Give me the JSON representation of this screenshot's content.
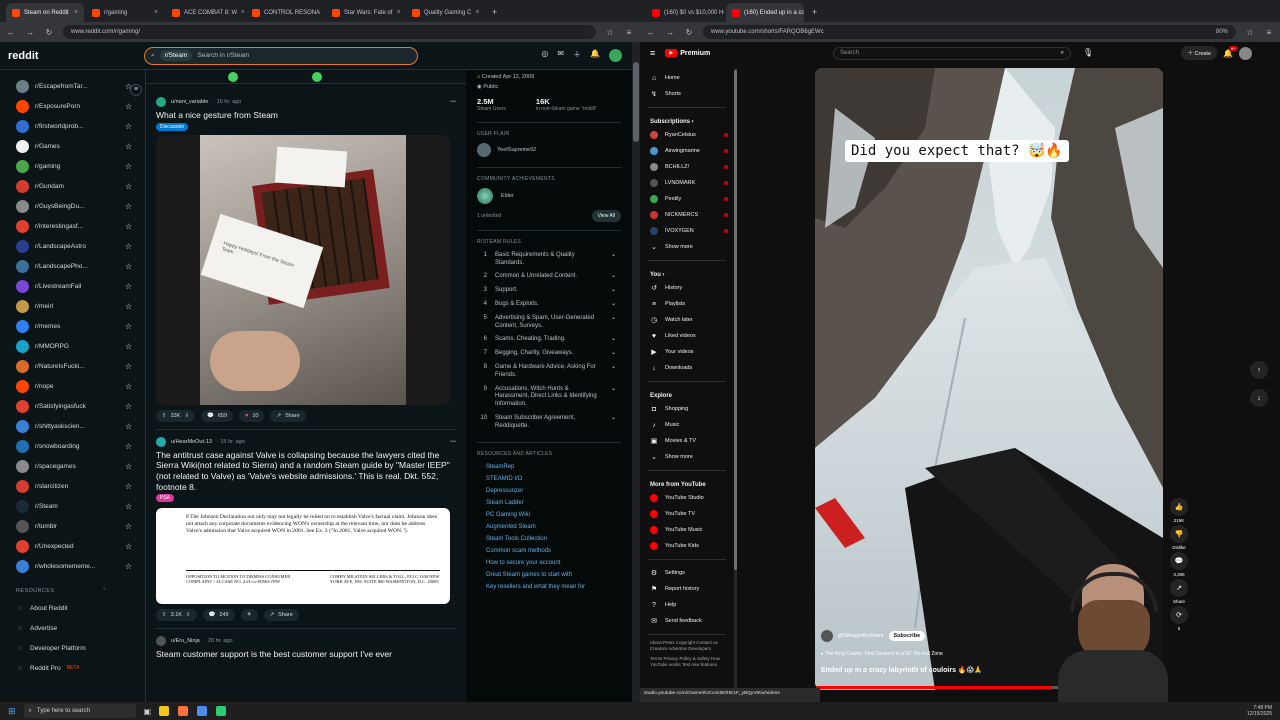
{
  "left_browser": {
    "tabs": [
      {
        "label": "Steam on Reddit",
        "color": "#ff4500",
        "active": true
      },
      {
        "label": "r/gaming",
        "color": "#ff4500",
        "active": false
      },
      {
        "label": "ACE COMBAT 8: W",
        "color": "#ff4500",
        "active": false
      },
      {
        "label": "CONTROL RESONA",
        "color": "#ff4500",
        "active": false
      },
      {
        "label": "Star Wars: Fate of",
        "color": "#ff4500",
        "active": false
      },
      {
        "label": "Quality Gaming C",
        "color": "#ff4500",
        "active": false
      }
    ],
    "url": "www.reddit.com/r/gaming/"
  },
  "reddit": {
    "logo": "reddit",
    "search_chip": "r/Steam",
    "search_placeholder": "Search in r/Steam",
    "notif_count": "1",
    "communities": [
      {
        "name": "r/EscapefromTar...",
        "color": "#6b7d85"
      },
      {
        "name": "r/ExposurePorn",
        "color": "#ff4500"
      },
      {
        "name": "r/firstworldprob...",
        "color": "#2f6fd1"
      },
      {
        "name": "r/Games",
        "color": "#f2f2f2"
      },
      {
        "name": "r/gaming",
        "color": "#4aa84a"
      },
      {
        "name": "r/Gundam",
        "color": "#d63b2f"
      },
      {
        "name": "r/GuysBeingDu...",
        "color": "#8a8a8a"
      },
      {
        "name": "r/interestingasf...",
        "color": "#e0402f"
      },
      {
        "name": "r/LandscapeAstro",
        "color": "#2a3e8f"
      },
      {
        "name": "r/LandscapePho...",
        "color": "#3a6f9a"
      },
      {
        "name": "r/LivestreamFail",
        "color": "#7a46d6"
      },
      {
        "name": "r/meirl",
        "color": "#c49a4a"
      },
      {
        "name": "r/memes",
        "color": "#2f7ff0"
      },
      {
        "name": "r/MMORPG",
        "color": "#19a3c6"
      },
      {
        "name": "r/NatureIsFucki...",
        "color": "#d96a2a"
      },
      {
        "name": "r/nope",
        "color": "#ff4500"
      },
      {
        "name": "r/Satisfyingasfuck",
        "color": "#e0402f"
      },
      {
        "name": "r/shittyaskscien...",
        "color": "#3a7fd6"
      },
      {
        "name": "r/snowboarding",
        "color": "#1f6fb5"
      },
      {
        "name": "r/spacegames",
        "color": "#8a8a8a"
      },
      {
        "name": "r/starcitizen",
        "color": "#d63b2f"
      },
      {
        "name": "r/Steam",
        "color": "#1b2838"
      },
      {
        "name": "r/tumblr",
        "color": "#555555"
      },
      {
        "name": "r/Unexpected",
        "color": "#e0402f"
      },
      {
        "name": "r/wholesomememe...",
        "color": "#3a7fd6"
      }
    ],
    "resources_header": "RESOURCES",
    "resources": [
      "About Reddit",
      "Advertise",
      "Developer Platform",
      "Reddit Pro"
    ],
    "reddit_pro_badge": "BETA",
    "posts": [
      {
        "author": "u/nani_variable",
        "time": "· 16 hr. ago",
        "title": "What a nice gesture from Steam",
        "flair": "Discussion",
        "flair_color": "#0079d3",
        "image_note": "Happy Holidays! From the Steam Team",
        "upvotes": "33K",
        "comments": "659",
        "awards": "10",
        "share": "Share"
      },
      {
        "author": "u/HearMeOut-13",
        "time": "· 15 hr. ago",
        "title": "The antitrust case against Valve is collapsing because the lawyers cited the Sierra Wiki(not related to Sierra) and a random Steam guide by \"Master IEEP\" (not related to Valve) as 'Valve's website admissions.' This is real. Dkt. 552, footnote 8.",
        "flair": "PSA",
        "flair_color": "#d93a9a",
        "upvotes": "3.1K",
        "comments": "249",
        "share": "Share"
      },
      {
        "author": "u/Eru_Ninja",
        "time": "· 20 hr. ago",
        "title": "Steam customer support is the best customer support I've ever"
      }
    ],
    "doc_footnote": "8 The Johnson Declaration not only may not legally be relied on to establish Valve's factual claim. Johnson does not attach any corporate documents evidencing WON's ownership at the relevant time, nor does he address Valve's admission that Valve acquired WON in 2001. See Ex. 3 (\"In 2001, Valve acquired WON.\").",
    "doc_left": "OPPOSITION TO MOTION TO DISMISS CONSUMER COMPLAINT - 14 CASE NO. 2:21-cv-00563-JNW",
    "doc_right": "COHEN MILSTEIN SELLERS & TOLL, PLLC 1100 NEW YORK AVE. NW, SUITE 800 WASHINGTON, D.C. 20005",
    "sidebar_info": {
      "created": "Created Apr 12, 2009",
      "visibility": "Public",
      "members": "2.5M",
      "members_label": "Steam Users",
      "online": "16K",
      "online_label": "in non-Steam game \"reddit\""
    },
    "user_flair_header": "USER FLAIR",
    "user_flair": "YeetSupreme92",
    "achievements_header": "COMMUNITY ACHIEVEMENTS",
    "achievement": "Elder",
    "achievement_unlocked": "1 unlocked",
    "view_all": "View All",
    "rules_header": "R/STEAM RULES",
    "rules": [
      {
        "n": "1",
        "t": "Basic Requirements & Quality Standards."
      },
      {
        "n": "2",
        "t": "Common & Unrelated Content."
      },
      {
        "n": "3",
        "t": "Support."
      },
      {
        "n": "4",
        "t": "Bugs & Exploits."
      },
      {
        "n": "5",
        "t": "Advertising & Spam, User-Generated Content, Surveys."
      },
      {
        "n": "6",
        "t": "Scams, Cheating, Trading."
      },
      {
        "n": "7",
        "t": "Begging, Charity, Giveaways."
      },
      {
        "n": "8",
        "t": "Game & Hardware Advice, Asking For Friends."
      },
      {
        "n": "9",
        "t": "Accusations, Witch Hunts & Harassment, Direct Links & Identifying Information."
      },
      {
        "n": "10",
        "t": "Steam Subscriber Agreement, Reddiquette."
      }
    ],
    "links_header": "RESOURCES AND ARTICLES",
    "links": [
      "SteamRep",
      "STEAMID I/O",
      "Depressurizer",
      "Steam Ladder",
      "PC Gaming Wiki",
      "Augmented Steam",
      "Steam Tools Collection",
      "Common scam methods",
      "How to secure your account",
      "Great Steam games to start with",
      "Key resellers and what they mean for"
    ]
  },
  "right_browser": {
    "tabs": [
      {
        "label": "(160) $0 vs $10,000 Holiday",
        "color": "#ff0000",
        "active": false
      },
      {
        "label": "(160) Ended up in a crazy la",
        "color": "#ff0000",
        "active": true
      }
    ],
    "url": "www.youtube.com/shorts/FARQOB6gEWc",
    "zoom": "80%"
  },
  "youtube": {
    "logo": "Premium",
    "search_placeholder": "Search",
    "create": "Create",
    "notif_count": "9+",
    "nav": [
      {
        "label": "Home",
        "icon": "⌂"
      },
      {
        "label": "Shorts",
        "icon": "↯"
      }
    ],
    "subscriptions_header": "Subscriptions",
    "subscriptions": [
      {
        "label": "RyanCelsius",
        "color": "#c44"
      },
      {
        "label": "Airwingmarine",
        "color": "#49c"
      },
      {
        "label": "BCHILLZ!",
        "color": "#888"
      },
      {
        "label": "LVNDMARK",
        "color": "#555"
      },
      {
        "label": "Pestily",
        "color": "#3a5"
      },
      {
        "label": "NICKMERCS",
        "color": "#c33"
      },
      {
        "label": "IVOXYGEN",
        "color": "#246"
      }
    ],
    "show_more": "Show more",
    "you_header": "You",
    "you_items": [
      {
        "label": "History",
        "icon": "↺"
      },
      {
        "label": "Playlists",
        "icon": "≡"
      },
      {
        "label": "Watch later",
        "icon": "◷"
      },
      {
        "label": "Liked videos",
        "icon": "♥"
      },
      {
        "label": "Your videos",
        "icon": "▶"
      },
      {
        "label": "Downloads",
        "icon": "↓"
      }
    ],
    "explore_header": "Explore",
    "explore_items": [
      {
        "label": "Shopping",
        "icon": "◘"
      },
      {
        "label": "Music",
        "icon": "♪"
      },
      {
        "label": "Movies & TV",
        "icon": "▣"
      }
    ],
    "more_header": "More from YouTube",
    "more_items": [
      "YouTube Studio",
      "YouTube TV",
      "YouTube Music",
      "YouTube Kids"
    ],
    "settings_items": [
      {
        "label": "Settings",
        "icon": "⚙"
      },
      {
        "label": "Report history",
        "icon": "⚑"
      },
      {
        "label": "Help",
        "icon": "?"
      },
      {
        "label": "Send feedback",
        "icon": "✉"
      }
    ],
    "footer1": "About Press Copyright Contact us Creators Advertise Developers",
    "footer2": "Terms Privacy Policy & Safety How YouTube works Test new features",
    "video": {
      "caption": "Did you expect that? 🤯🔥",
      "channel": "@WeegerBrothers",
      "subscribe": "Subscribe",
      "music": "The King Couloir: First Descent in a 56\" No-Fall Zone",
      "title": "Ended up in a crazy labyrinth of couloirs 🔥😱🙏",
      "likes": "219K",
      "dislike": "Dislike",
      "comments": "3,366",
      "share": "Share",
      "remix": "5"
    }
  },
  "status_url": "studio.youtube.com/channel/UCx4c6EfHE1F_yBQyVtKw/videos",
  "taskbar": {
    "search_placeholder": "Type here to search",
    "time": "7:48 PM",
    "date": "12/15/2025",
    "apps": [
      "#f5c518",
      "#ff7139",
      "#4a8ef0",
      "#2dcc70"
    ]
  }
}
